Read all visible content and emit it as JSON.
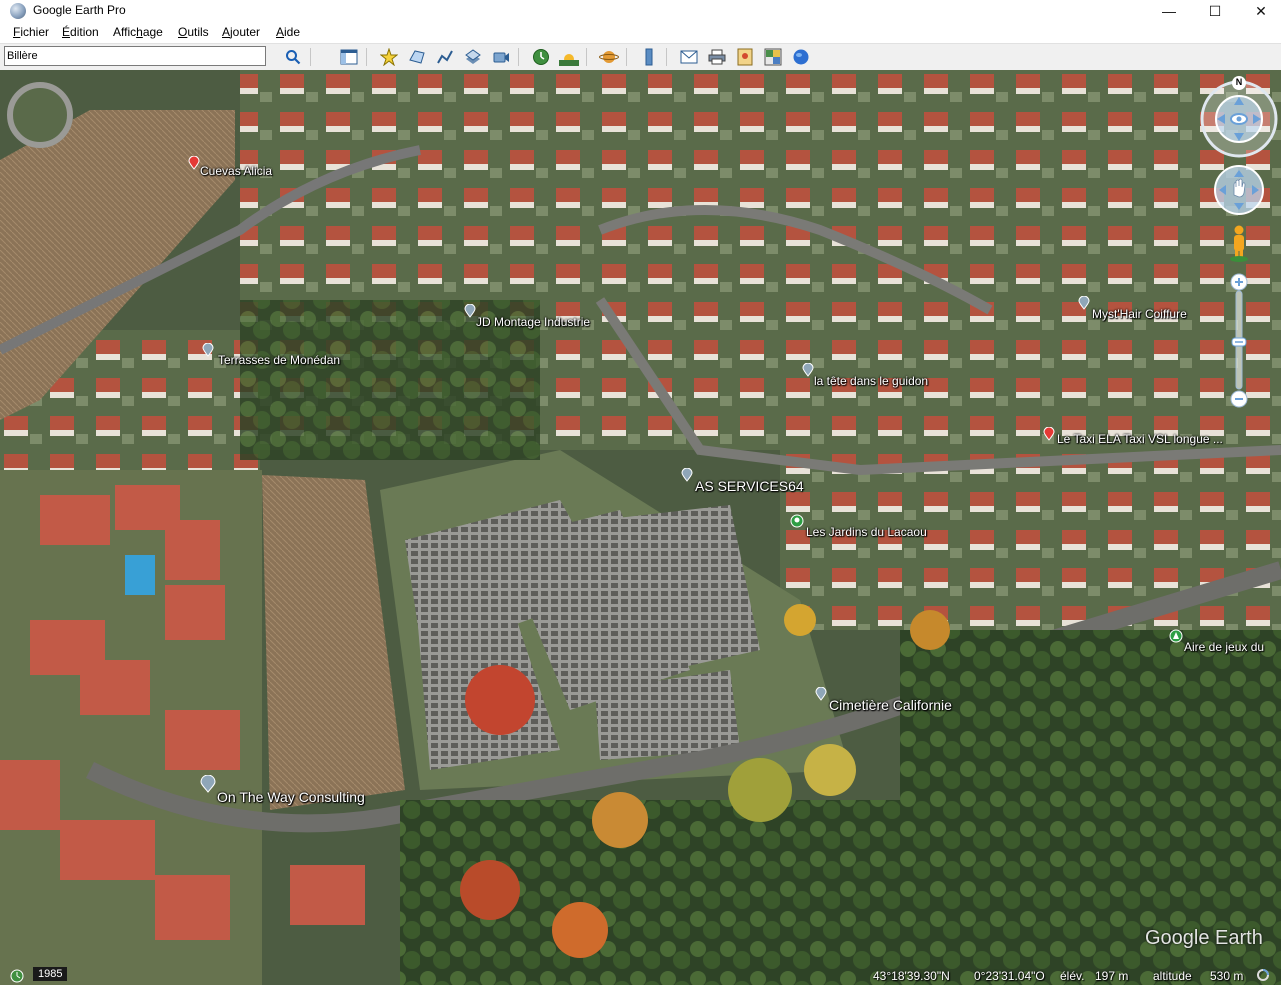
{
  "window": {
    "title": "Google Earth Pro",
    "minimize": "—",
    "maximize": "☐",
    "close": "✕"
  },
  "menu": [
    {
      "u": "F",
      "rest": "ichier"
    },
    {
      "u": "É",
      "rest": "dition"
    },
    {
      "pre": "Affic",
      "u": "h",
      "rest": "age"
    },
    {
      "u": "O",
      "rest": "utils"
    },
    {
      "u": "A",
      "rest": "jouter"
    },
    {
      "u": "A",
      "rest": "ide"
    }
  ],
  "search": {
    "value": "Billère"
  },
  "toolbar_icons": [
    "search-icon",
    "sidebar-icon",
    "placemark-icon",
    "polygon-icon",
    "path-icon",
    "overlay-icon",
    "tour-icon",
    "historical-imagery-icon",
    "sun-icon",
    "planets-icon",
    "ruler-icon",
    "email-icon",
    "print-icon",
    "save-image-icon",
    "maps-icon",
    "globe-icon"
  ],
  "places": [
    {
      "name": "Cuevas Alicia",
      "icon": "red-pin-icon"
    },
    {
      "name": "JD Montage Industrie",
      "icon": "place-pin-icon"
    },
    {
      "name": "Terrasses de Monédan",
      "icon": "place-pin-icon"
    },
    {
      "name": "Myst'Hair Coiffure",
      "icon": "place-pin-icon"
    },
    {
      "name": "la tête dans le guidon",
      "icon": "place-pin-icon"
    },
    {
      "name": "Le Taxi ELA Taxi VSL longue ...",
      "icon": "red-pin-icon"
    },
    {
      "name": "AS SERVICES64",
      "icon": "place-pin-icon"
    },
    {
      "name": "Les Jardins du Lacaou",
      "icon": "park-pin-icon"
    },
    {
      "name": "Aire de jeux du",
      "icon": "park-pin-icon"
    },
    {
      "name": "Cimetière Californie",
      "icon": "place-pin-icon"
    },
    {
      "name": "On The Way Consulting",
      "icon": "place-pin-icon"
    }
  ],
  "navigation": {
    "north": "N"
  },
  "branding": {
    "watermark": "Google Earth"
  },
  "status": {
    "year": "1985",
    "latitude": "43°18'39.30\"N",
    "longitude": "0°23'31.04\"O",
    "elevation_label": "élév.",
    "elevation": "197 m",
    "altitude_label": "altitude",
    "altitude": "530 m"
  },
  "colors": {
    "toolbar_bg": "#f0f0f0",
    "red_pin": "#e53935",
    "park_pin": "#2e9e44",
    "nav_blue": "#6aa0d8"
  }
}
